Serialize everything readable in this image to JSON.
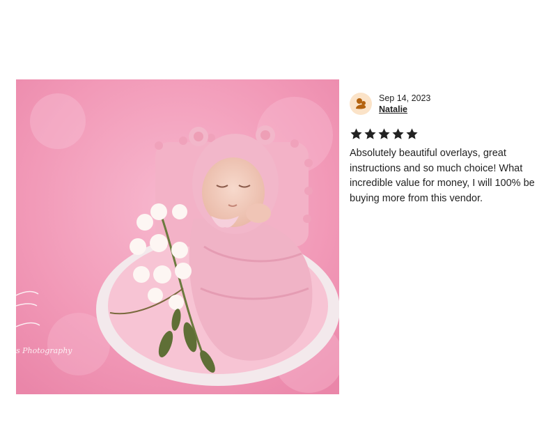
{
  "review": {
    "date": "Sep 14, 2023",
    "reviewer_name": "Natalie",
    "rating": 5,
    "rating_max": 5,
    "text": "Absolutely beautiful overlays, great instructions and so much choice! What incredible value for money, I will 100% be buying more from this vendor."
  },
  "photo": {
    "watermark": "s Photography"
  },
  "colors": {
    "star": "#222222",
    "avatar_bg": "#fbe3c8",
    "avatar_icon": "#b4630f",
    "photo_bg": "#f29ab8"
  },
  "icons": {
    "avatar": "user-avatar-icon",
    "star": "star-icon"
  }
}
